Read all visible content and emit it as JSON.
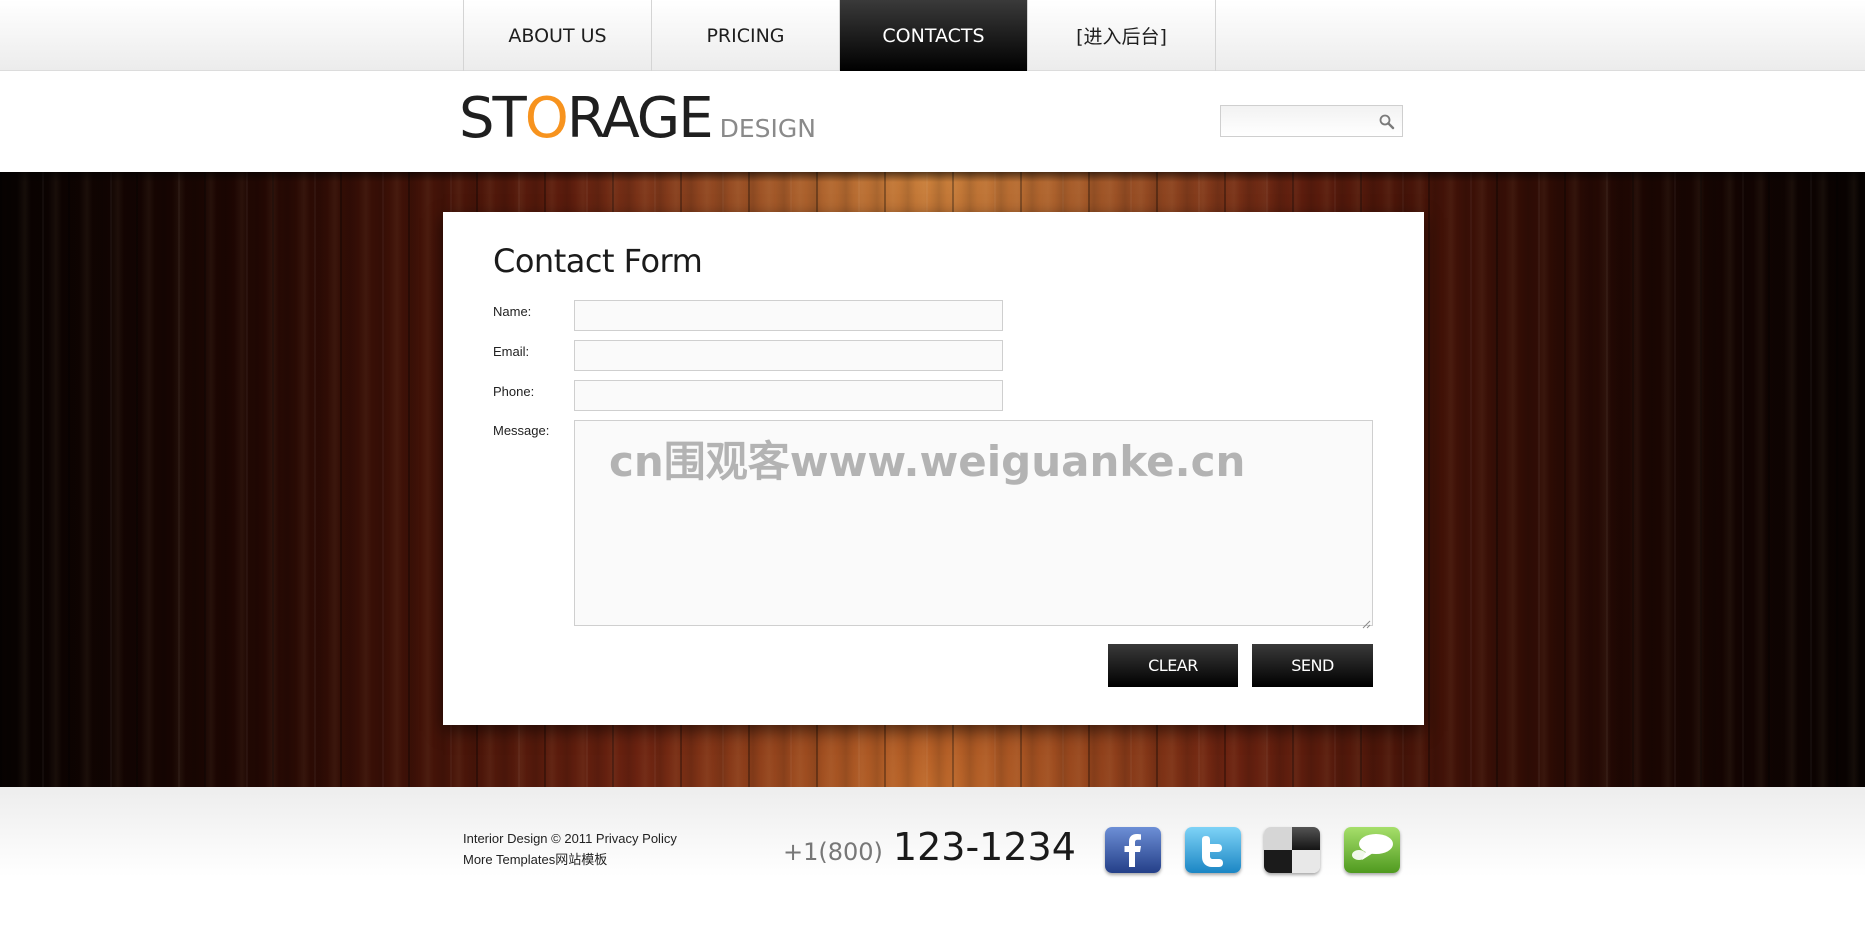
{
  "nav": {
    "items": [
      {
        "label": "ABOUT US"
      },
      {
        "label": "PRICING"
      },
      {
        "label": "CONTACTS"
      },
      {
        "label": "[进入后台]"
      }
    ],
    "active_index": 2
  },
  "header": {
    "logo": {
      "part1": "ST",
      "accent": "O",
      "part2": "RAGE",
      "sub": "DESIGN"
    },
    "search": {
      "value": "",
      "placeholder": ""
    }
  },
  "form": {
    "title": "Contact Form",
    "fields": {
      "name": {
        "label": "Name:",
        "value": ""
      },
      "email": {
        "label": "Email:",
        "value": ""
      },
      "phone": {
        "label": "Phone:",
        "value": ""
      },
      "message": {
        "label": "Message:",
        "value": ""
      }
    },
    "buttons": {
      "clear": "CLEAR",
      "send": "SEND"
    }
  },
  "watermark": "cn围观客www.weiguanke.cn",
  "footer": {
    "copyright": "Interior Design © 2011 ",
    "privacy": "Privacy Policy",
    "more": "More Templates网站模板",
    "phone_prefix": "+1(800)",
    "phone_number": "123-1234",
    "social": [
      {
        "icon": "facebook-icon"
      },
      {
        "icon": "twitter-icon"
      },
      {
        "icon": "delicious-icon"
      },
      {
        "icon": "chat-icon"
      }
    ]
  },
  "colors": {
    "accent": "#f7931e",
    "dark": "#000000",
    "wood": "#8a3415"
  }
}
